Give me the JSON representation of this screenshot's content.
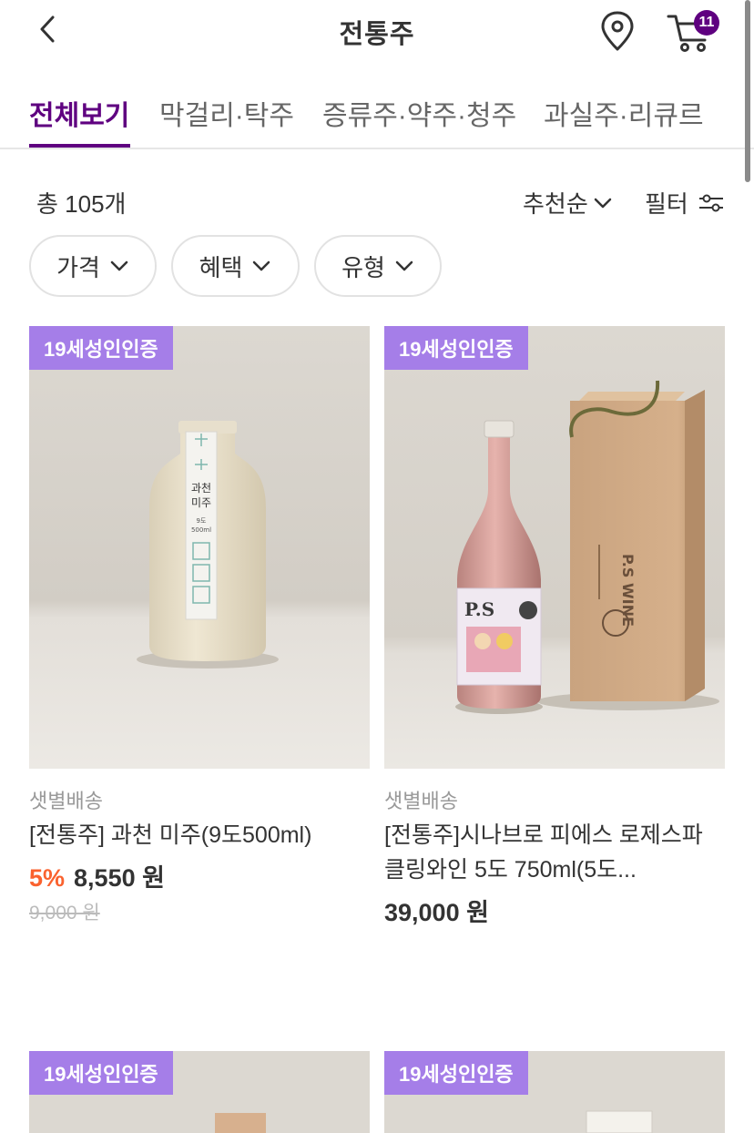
{
  "header": {
    "title": "전통주",
    "cart_count": "11"
  },
  "tabs": [
    {
      "label": "전체보기",
      "active": true
    },
    {
      "label": "막걸리·탁주",
      "active": false
    },
    {
      "label": "증류주·약주·청주",
      "active": false
    },
    {
      "label": "과실주·리큐르",
      "active": false
    }
  ],
  "listing": {
    "count": "총 105개",
    "sort_label": "추천순",
    "filter_label": "필터"
  },
  "chips": [
    {
      "label": "가격"
    },
    {
      "label": "혜택"
    },
    {
      "label": "유형"
    }
  ],
  "products": [
    {
      "tag": "19세성인인증",
      "delivery": "샛별배송",
      "name": "[전통주] 과천 미주(9도500ml)",
      "discount": "5%",
      "price": "8,550 원",
      "original_price": "9,000 원",
      "bottle_label": {
        "line1": "과천",
        "line2": "미주",
        "small1": "9도",
        "small2": "500ml"
      }
    },
    {
      "tag": "19세성인인증",
      "delivery": "샛별배송",
      "name": "[전통주]시나브로 피에스 로제스파클링와인 5도 750ml(5도...",
      "discount": "",
      "price": "39,000 원",
      "original_price": "",
      "bottle_label": {
        "brand": "P.S",
        "box_text": "P.S WINE"
      }
    },
    {
      "tag": "19세성인인증"
    },
    {
      "tag": "19세성인인증"
    }
  ],
  "colors": {
    "brand": "#5f0080",
    "tag_bg": "#a57ee8",
    "discount": "#fa622f"
  }
}
